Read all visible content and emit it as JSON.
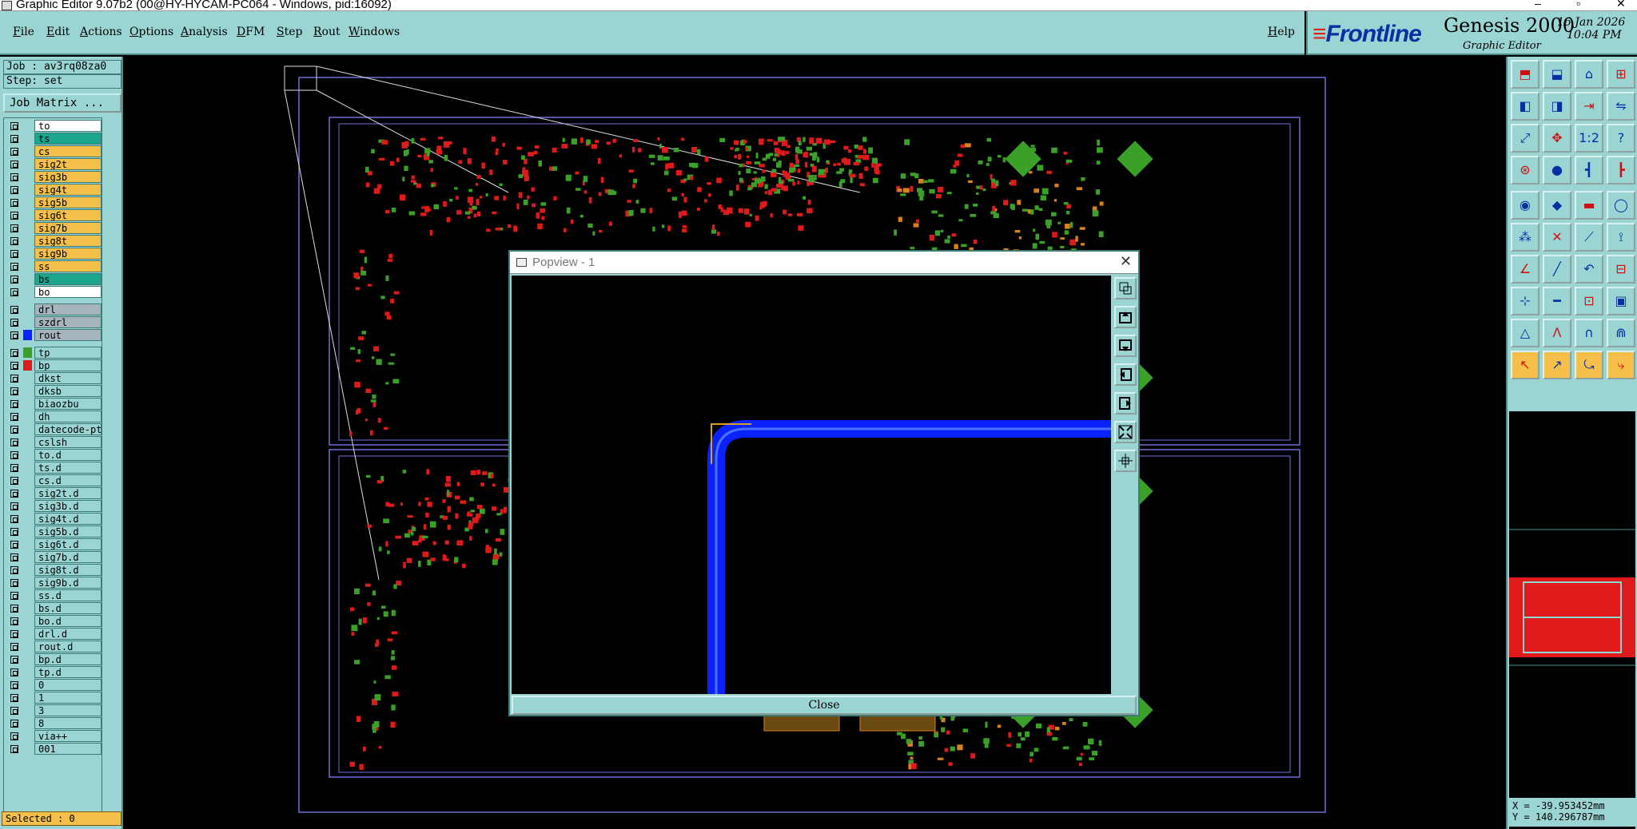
{
  "window": {
    "title": "Graphic Editor 9.07b2 (00@HY-HYCAM-PC064 - Windows, pid:16092)"
  },
  "menu": {
    "items": [
      "File",
      "Edit",
      "Actions",
      "Options",
      "Analysis",
      "DFM",
      "Step",
      "Rout",
      "Windows"
    ],
    "help": "Help"
  },
  "brand": {
    "logo": "Frontline",
    "product": "Genesis 2000",
    "subtitle": "Graphic Editor",
    "date": "16 Jan 2026",
    "time": "10:04 PM"
  },
  "job": {
    "job_label": "Job : av3rq08za0",
    "step_label": "Step: set",
    "job_matrix": "Job Matrix ..."
  },
  "layers": [
    {
      "name": "to",
      "color": "#ffffff"
    },
    {
      "name": "ts",
      "color": "#1aa58c"
    },
    {
      "name": "cs",
      "color": "#f4c04a"
    },
    {
      "name": "sig2t",
      "color": "#f4c04a"
    },
    {
      "name": "sig3b",
      "color": "#f4c04a"
    },
    {
      "name": "sig4t",
      "color": "#f4c04a"
    },
    {
      "name": "sig5b",
      "color": "#f4c04a"
    },
    {
      "name": "sig6t",
      "color": "#f4c04a"
    },
    {
      "name": "sig7b",
      "color": "#f4c04a"
    },
    {
      "name": "sig8t",
      "color": "#f4c04a"
    },
    {
      "name": "sig9b",
      "color": "#f4c04a"
    },
    {
      "name": "ss",
      "color": "#f4c04a"
    },
    {
      "name": "bs",
      "color": "#1aa58c"
    },
    {
      "name": "bo",
      "color": "#ffffff"
    },
    {
      "name": "drl",
      "color": "#a6b4bc"
    },
    {
      "name": "szdrl",
      "color": "#a6b4bc"
    },
    {
      "name": "rout",
      "color": "#a6b4bc",
      "swatch": "#0a22ff"
    },
    {
      "name": "tp",
      "color": "#9ad5d3",
      "swatch": "#3aa028"
    },
    {
      "name": "bp",
      "color": "#9ad5d3",
      "swatch": "#e01a1a"
    },
    {
      "name": "dkst",
      "color": "#9ad5d3"
    },
    {
      "name": "dksb",
      "color": "#9ad5d3"
    },
    {
      "name": "biaozbu",
      "color": "#9ad5d3"
    },
    {
      "name": "dh",
      "color": "#9ad5d3"
    },
    {
      "name": "datecode-ptc",
      "color": "#9ad5d3"
    },
    {
      "name": "cslsh",
      "color": "#9ad5d3"
    },
    {
      "name": "to.d",
      "color": "#9ad5d3"
    },
    {
      "name": "ts.d",
      "color": "#9ad5d3"
    },
    {
      "name": "cs.d",
      "color": "#9ad5d3"
    },
    {
      "name": "sig2t.d",
      "color": "#9ad5d3"
    },
    {
      "name": "sig3b.d",
      "color": "#9ad5d3"
    },
    {
      "name": "sig4t.d",
      "color": "#9ad5d3"
    },
    {
      "name": "sig5b.d",
      "color": "#9ad5d3"
    },
    {
      "name": "sig6t.d",
      "color": "#9ad5d3"
    },
    {
      "name": "sig7b.d",
      "color": "#9ad5d3"
    },
    {
      "name": "sig8t.d",
      "color": "#9ad5d3"
    },
    {
      "name": "sig9b.d",
      "color": "#9ad5d3"
    },
    {
      "name": "ss.d",
      "color": "#9ad5d3"
    },
    {
      "name": "bs.d",
      "color": "#9ad5d3"
    },
    {
      "name": "bo.d",
      "color": "#9ad5d3"
    },
    {
      "name": "drl.d",
      "color": "#9ad5d3"
    },
    {
      "name": "rout.d",
      "color": "#9ad5d3"
    },
    {
      "name": "bp.d",
      "color": "#9ad5d3"
    },
    {
      "name": "tp.d",
      "color": "#9ad5d3"
    },
    {
      "name": "0",
      "color": "#9ad5d3"
    },
    {
      "name": "1",
      "color": "#9ad5d3"
    },
    {
      "name": "3",
      "color": "#9ad5d3"
    },
    {
      "name": "8",
      "color": "#9ad5d3"
    },
    {
      "name": "via++",
      "color": "#9ad5d3"
    },
    {
      "name": "001",
      "color": "#9ad5d3"
    }
  ],
  "status": {
    "selected": "Selected : 0"
  },
  "popview": {
    "title": "Popview - 1",
    "close_label": "Close"
  },
  "coords": {
    "x": "X = -39.953452mm",
    "y": "Y = 140.296787mm"
  },
  "colors": {
    "panel": "#9ad5d3",
    "rout": "#0a22ff",
    "pad_green": "#3aa028",
    "pad_red": "#e01a1a",
    "profile": "#6f6fd8",
    "highlight": "#f4c04a"
  }
}
